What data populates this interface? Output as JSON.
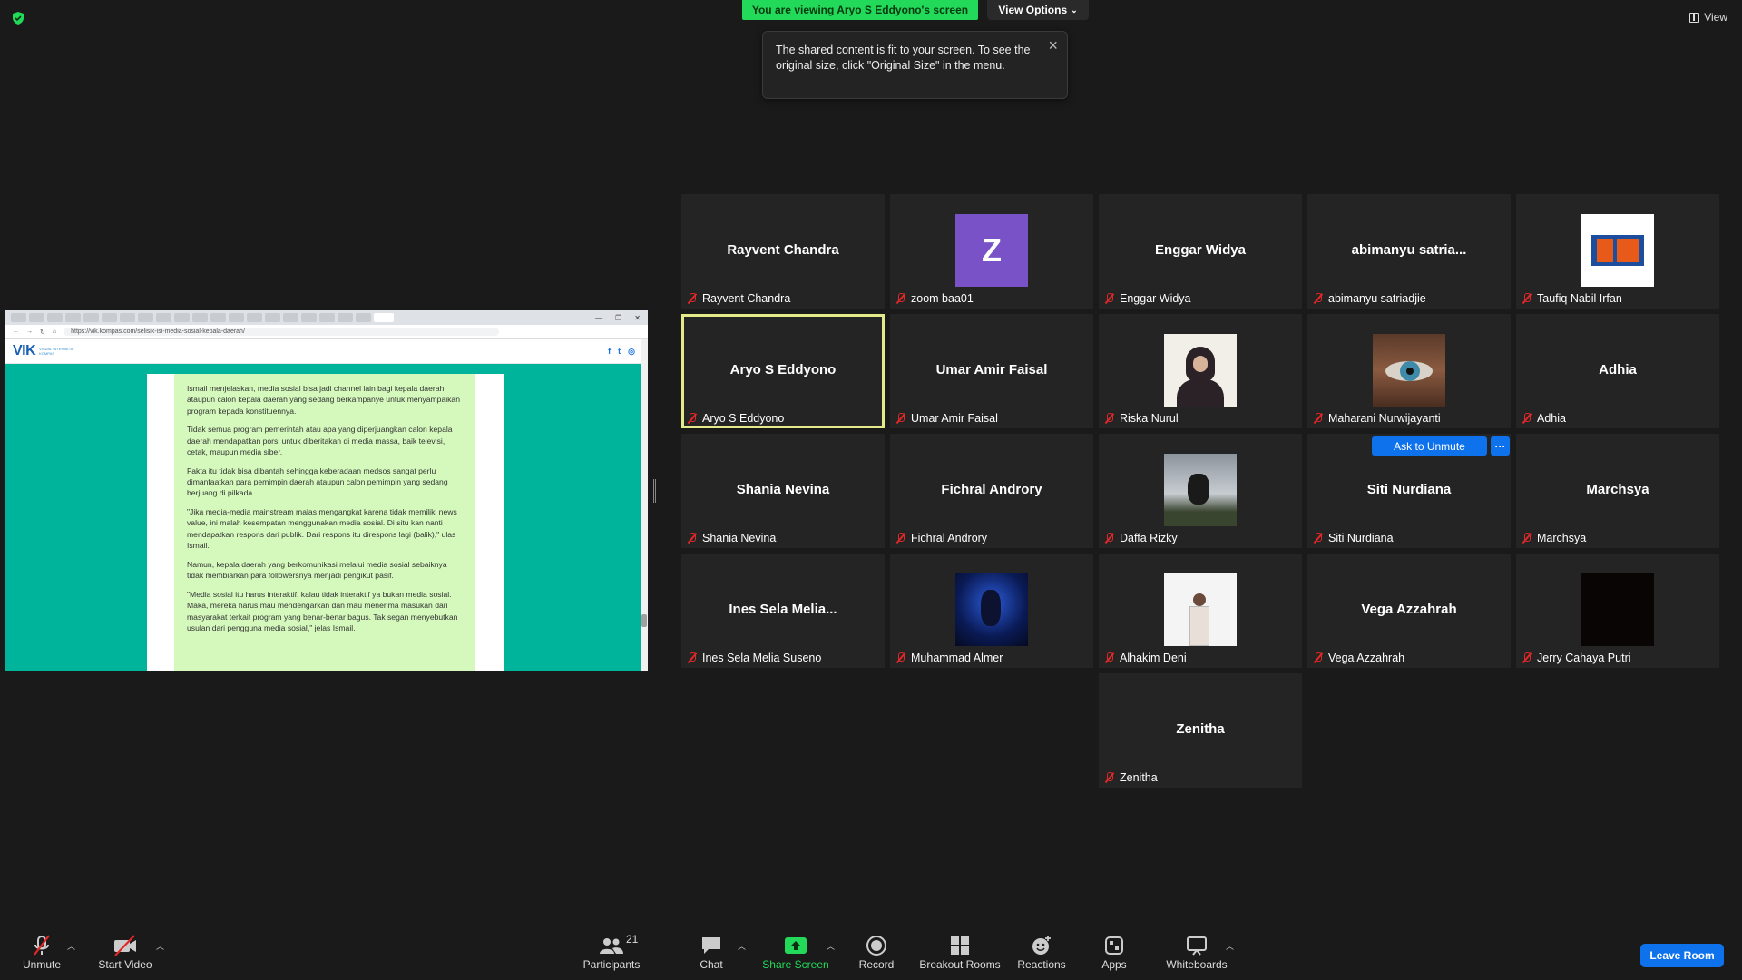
{
  "banner": {
    "viewing_text": "You are viewing Aryo S Eddyono's screen",
    "view_options_label": "View Options",
    "view_label": "View"
  },
  "tooltip": {
    "text": "The shared content is fit to your screen. To see the original size, click \"Original Size\" in the menu."
  },
  "shared_screen": {
    "url": "https://vik.kompas.com/selisik-isi-media-sosial-kepala-daerah/",
    "site_logo": "VIK",
    "site_logo_sub": "VISUAL INTERAKTIF KOMPAS",
    "social_icons": [
      "facebook-icon",
      "twitter-icon",
      "whatsapp-icon"
    ],
    "paragraphs": [
      "Ismail menjelaskan, media sosial bisa jadi channel lain bagi kepala daerah ataupun calon kepala daerah yang sedang berkampanye untuk menyampaikan program kepada konstituennya.",
      "Tidak semua program pemerintah atau apa yang diperjuangkan calon kepala daerah mendapatkan porsi untuk diberitakan di media massa, baik televisi, cetak, maupun media siber.",
      "Fakta itu tidak bisa dibantah sehingga keberadaan medsos sangat perlu dimanfaatkan para pemimpin daerah ataupun calon pemimpin yang sedang berjuang di pilkada.",
      "\"Jika media-media mainstream malas mengangkat karena tidak memiliki news value, ini malah kesempatan menggunakan media sosial. Di situ kan nanti mendapatkan respons dari publik. Dari respons itu direspons lagi (balik),\" ulas Ismail.",
      "Namun, kepala daerah yang berkomunikasi melalui media sosial sebaiknya tidak membiarkan para followersnya menjadi pengikut pasif.",
      "\"Media sosial itu harus interaktif, kalau tidak interaktif ya bukan media sosial. Maka, mereka harus mau mendengarkan dan mau menerima masukan dari masyarakat terkait program yang benar-benar bagus. Tak segan menyebutkan usulan dari pengguna media sosial,\" jelas Ismail."
    ]
  },
  "participants": [
    {
      "display": "Rayvent Chandra",
      "label": "Rayvent Chandra",
      "type": "name"
    },
    {
      "display": "Z",
      "label": "zoom baa01",
      "type": "letter"
    },
    {
      "display": "Enggar Widya",
      "label": "Enggar Widya",
      "type": "name"
    },
    {
      "display": "abimanyu  satria...",
      "label": "abimanyu satriadjie",
      "type": "name"
    },
    {
      "display": "",
      "label": "Taufiq Nabil Irfan",
      "type": "photo-logo"
    },
    {
      "display": "Aryo S Eddyono",
      "label": "Aryo S Eddyono",
      "type": "name"
    },
    {
      "display": "Umar Amir Faisal",
      "label": "Umar Amir Faisal",
      "type": "name"
    },
    {
      "display": "",
      "label": "Riska Nurul",
      "type": "photo-hijab"
    },
    {
      "display": "",
      "label": "Maharani Nurwijayanti",
      "type": "photo-eye"
    },
    {
      "display": "Adhia",
      "label": "Adhia",
      "type": "name"
    },
    {
      "display": "Shania Nevina",
      "label": "Shania Nevina",
      "type": "name"
    },
    {
      "display": "Fichral Androry",
      "label": "Fichral Androry",
      "type": "name"
    },
    {
      "display": "",
      "label": "Daffa Rizky",
      "type": "photo-sky"
    },
    {
      "display": "Siti Nurdiana",
      "label": "Siti Nurdiana",
      "type": "name"
    },
    {
      "display": "Marchsya",
      "label": "Marchsya",
      "type": "name"
    },
    {
      "display": "Ines  Sela  Melia...",
      "label": "Ines Sela Melia Suseno",
      "type": "name"
    },
    {
      "display": "",
      "label": "Muhammad Almer",
      "type": "photo-dark-blue"
    },
    {
      "display": "",
      "label": "Alhakim Deni",
      "type": "photo-person"
    },
    {
      "display": "Vega Azzahrah",
      "label": "Vega Azzahrah",
      "type": "name"
    },
    {
      "display": "",
      "label": "Jerry Cahaya Putri",
      "type": "photo-black"
    },
    {
      "display": "Zenitha",
      "label": "Zenitha",
      "type": "name"
    }
  ],
  "tile_actions": {
    "ask_unmute": "Ask to Unmute",
    "more": "···"
  },
  "toolbar": {
    "unmute": "Unmute",
    "start_video": "Start Video",
    "participants": "Participants",
    "participants_count": "21",
    "chat": "Chat",
    "share_screen": "Share Screen",
    "record": "Record",
    "breakout_rooms": "Breakout Rooms",
    "reactions": "Reactions",
    "apps": "Apps",
    "whiteboards": "Whiteboards",
    "leave_room": "Leave Room"
  },
  "colors": {
    "accent_green": "#23d959",
    "accent_blue": "#0e72ed",
    "active_speaker": "#e4e98a",
    "muted_red": "#e02828"
  }
}
